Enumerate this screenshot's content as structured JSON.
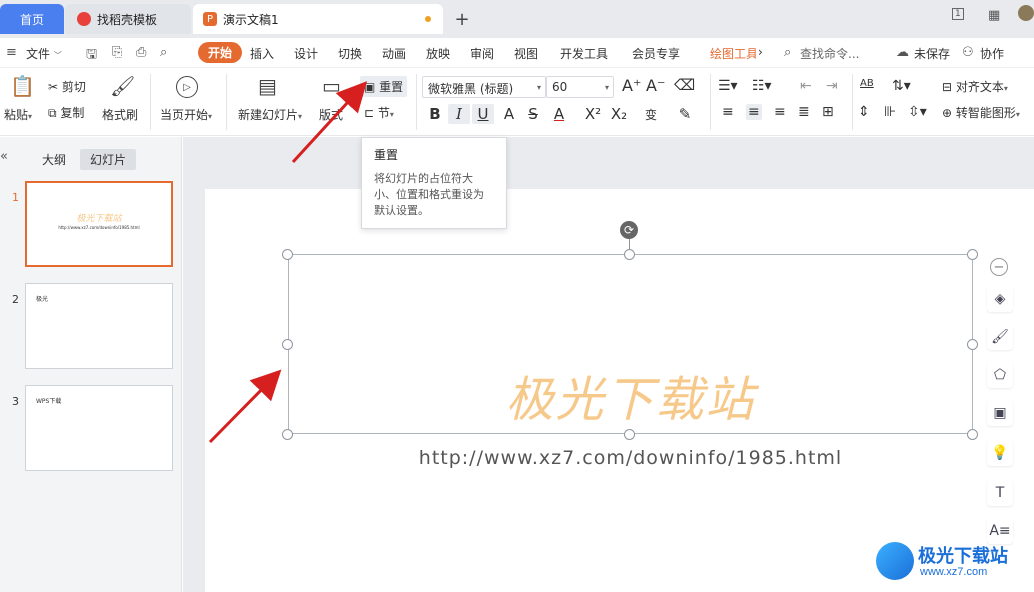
{
  "tabs": {
    "home": "首页",
    "template": "找稻壳模板",
    "document": "演示文稿1",
    "add": "+"
  },
  "menu": {
    "file": "文件",
    "items": [
      "开始",
      "插入",
      "设计",
      "切换",
      "动画",
      "放映",
      "审阅",
      "视图",
      "开发工具",
      "会员专享",
      "绘图工具"
    ],
    "more": "›",
    "search": "查找命令...",
    "unsaved": "未保存",
    "collab": "协作"
  },
  "ribbon": {
    "paste": "粘贴",
    "cut": "剪切",
    "copy": "复制",
    "format_painter": "格式刷",
    "start_from_current": "当页开始",
    "new_slide": "新建幻灯片",
    "layout": "版式",
    "reset": "重置",
    "section": "节",
    "font_name": "微软雅黑 (标题)",
    "font_size": "60",
    "align_text": "对齐文本",
    "smart_shape": "转智能图形",
    "ab_label": "AB"
  },
  "tooltip": {
    "title": "重置",
    "description": "将幻灯片的占位符大小、位置和格式重设为默认设置。"
  },
  "left_panel": {
    "collapse": "«",
    "outline_tab": "大纲",
    "slides_tab": "幻灯片",
    "thumbnails": [
      {
        "num": "1",
        "title": "极光下载站",
        "sub": "http://www.xz7.com/downinfo/1985.html"
      },
      {
        "num": "2",
        "title": "极光",
        "sub": ""
      },
      {
        "num": "3",
        "title": "WPS下载",
        "sub": ""
      }
    ]
  },
  "slide": {
    "title": "极光下载站",
    "subtitle": "http://www.xz7.com/downinfo/1985.html"
  },
  "watermark": {
    "name": "极光下载站",
    "url": "www.xz7.com"
  },
  "colors": {
    "accent": "#e56a30",
    "home_tab": "#4a7ff0",
    "arrow": "#d62020",
    "slide_title": "#f6c98a"
  }
}
